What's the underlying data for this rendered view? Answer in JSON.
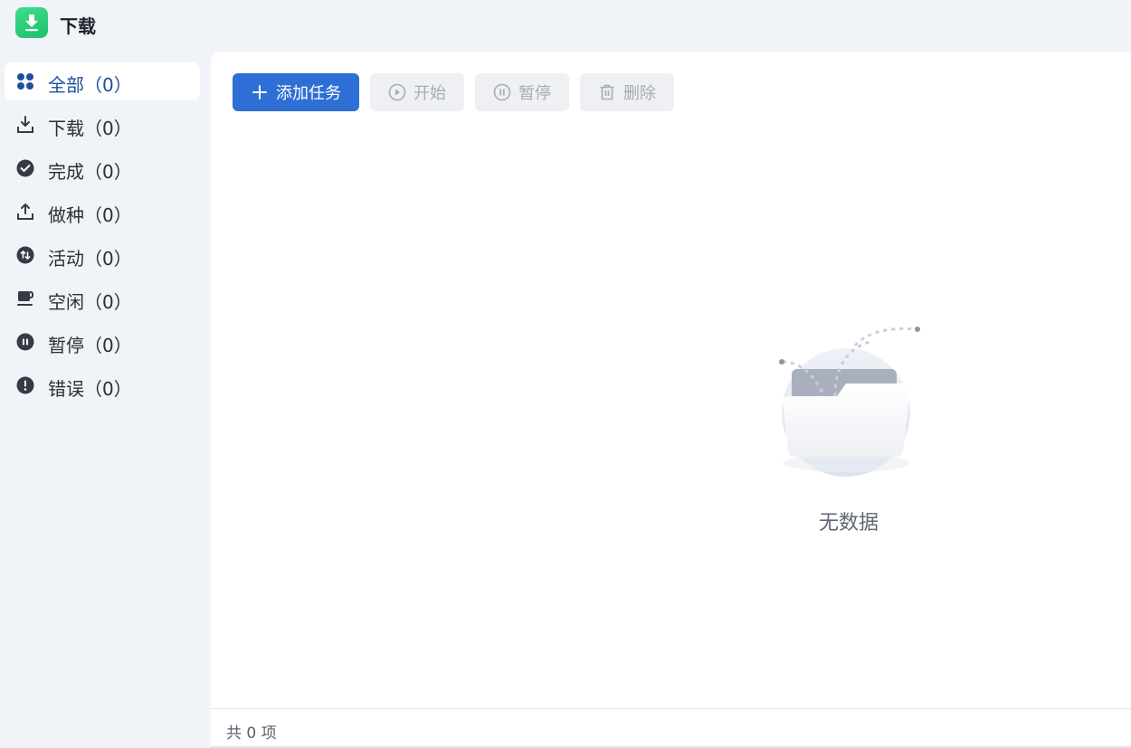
{
  "app": {
    "title": "下载",
    "icon": "download-app-icon",
    "accent": "#2e6fd6",
    "brand": "#22c474"
  },
  "sidebar": {
    "items": [
      {
        "label": "全部（0）",
        "icon": "grid-icon",
        "active": true
      },
      {
        "label": "下载（0）",
        "icon": "download-tray-icon"
      },
      {
        "label": "完成（0）",
        "icon": "check-circle-icon"
      },
      {
        "label": "做种（0）",
        "icon": "upload-tray-icon"
      },
      {
        "label": "活动（0）",
        "icon": "transfer-circle-icon"
      },
      {
        "label": "空闲（0）",
        "icon": "coffee-cup-icon"
      },
      {
        "label": "暂停（0）",
        "icon": "pause-circle-icon"
      },
      {
        "label": "错误（0）",
        "icon": "exclamation-circle-icon"
      }
    ]
  },
  "toolbar": {
    "add_label": "添加任务",
    "start_label": "开始",
    "pause_label": "暂停",
    "delete_label": "删除"
  },
  "empty": {
    "text": "无数据",
    "icon": "empty-folder-icon"
  },
  "footer": {
    "count_text": "共 0 项"
  }
}
